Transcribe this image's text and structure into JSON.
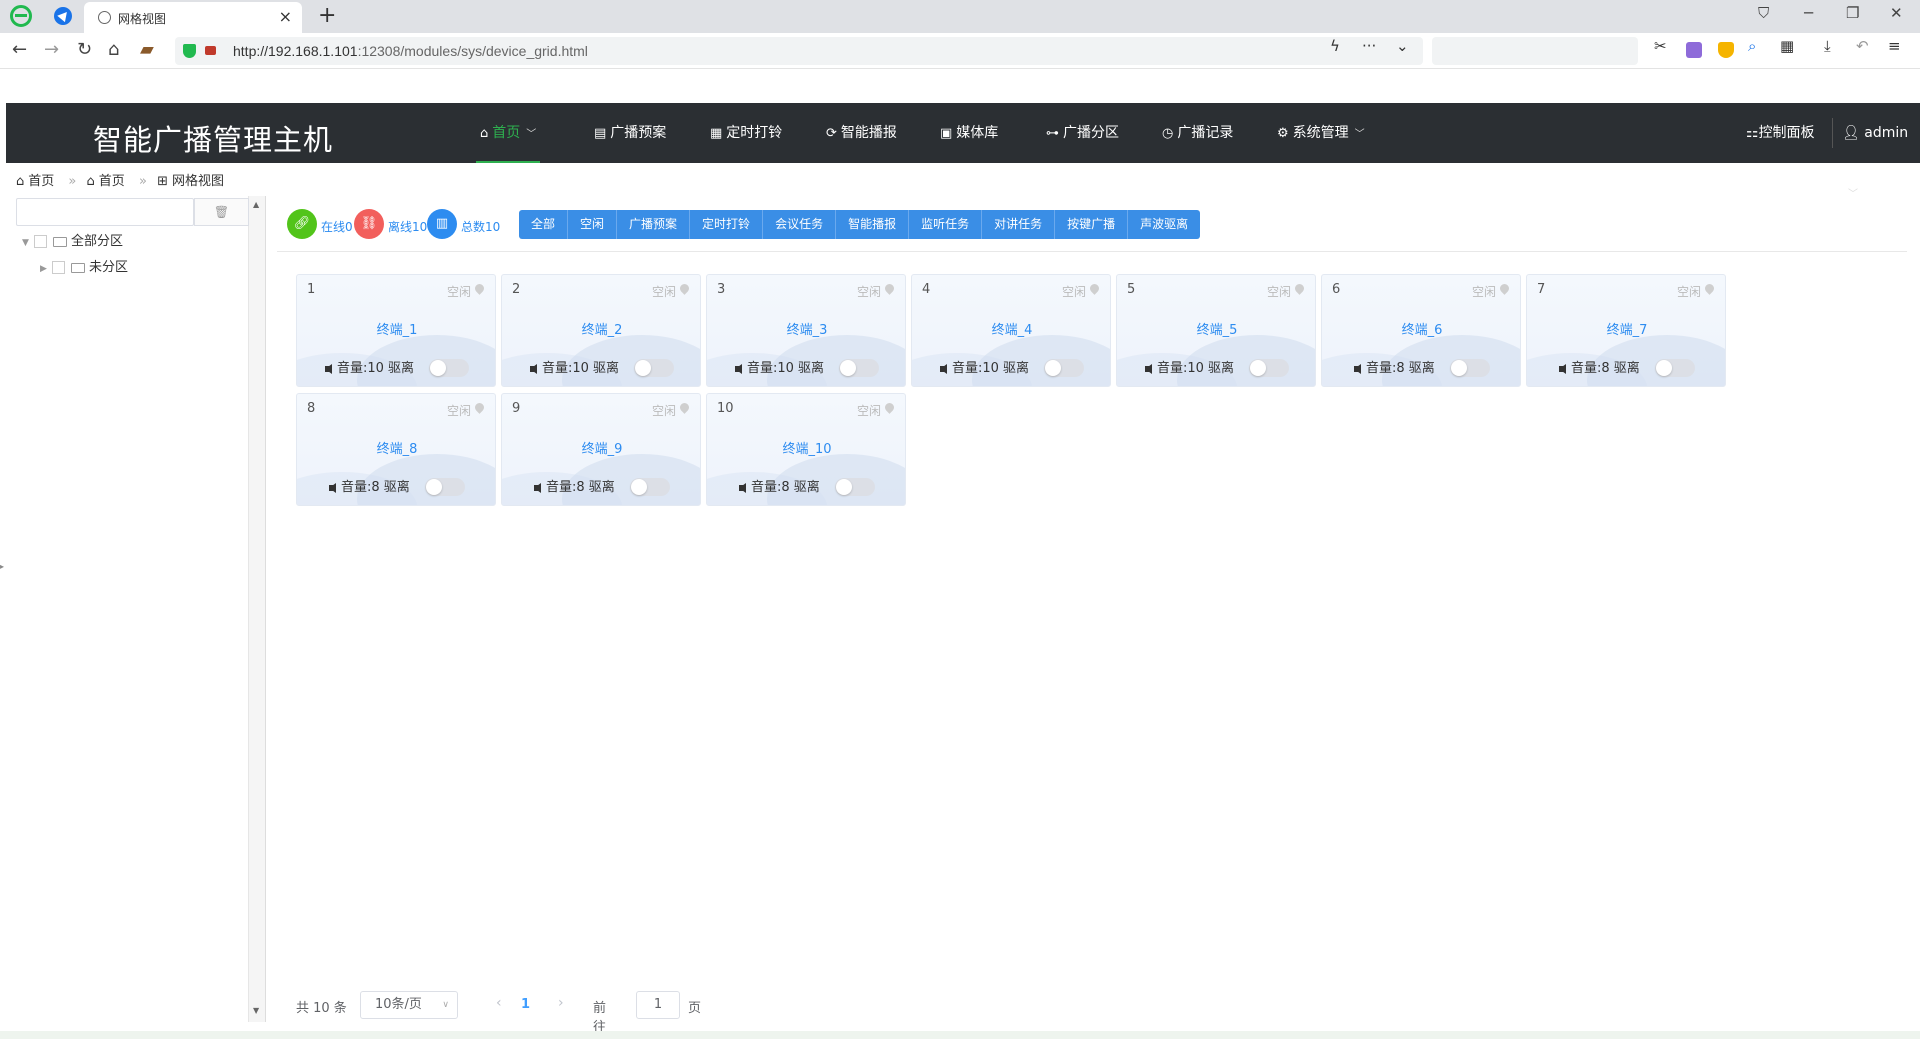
{
  "browser": {
    "tab_title": "网格视图",
    "close_glyph": "×",
    "new_tab_glyph": "+",
    "url_host": "http://192.168.1.101",
    "url_path": ":12308/modules/sys/device_grid.html"
  },
  "app": {
    "title": "智能广播管理主机",
    "nav": [
      {
        "label": "首页",
        "icon": "home-icon"
      },
      {
        "label": "广播预案",
        "icon": "list-icon"
      },
      {
        "label": "定时打铃",
        "icon": "calendar-icon"
      },
      {
        "label": "智能播报",
        "icon": "refresh-icon"
      },
      {
        "label": "媒体库",
        "icon": "media-icon"
      },
      {
        "label": "广播分区",
        "icon": "sitemap-icon"
      },
      {
        "label": "广播记录",
        "icon": "history-icon"
      },
      {
        "label": "系统管理",
        "icon": "gear-icon"
      }
    ],
    "control_panel": "控制面板",
    "user": "admin"
  },
  "breadcrumb": [
    "首页",
    "首页",
    "网格视图"
  ],
  "tree": {
    "clear_icon": "trash-icon",
    "items": [
      "全部分区",
      "未分区"
    ]
  },
  "stats": {
    "online": "在线0",
    "offline": "离线10",
    "total": "总数10",
    "colors": {
      "online": "#52c41a",
      "offline": "#f25f5c",
      "total": "#2d8cf0"
    }
  },
  "filters": [
    "全部",
    "空闲",
    "广播预案",
    "定时打铃",
    "会议任务",
    "智能播报",
    "监听任务",
    "对讲任务",
    "按键广播",
    "声波驱离"
  ],
  "devices": [
    {
      "num": "1",
      "state": "空闲",
      "name": "终端_1",
      "volume": "音量:10 驱离"
    },
    {
      "num": "2",
      "state": "空闲",
      "name": "终端_2",
      "volume": "音量:10 驱离"
    },
    {
      "num": "3",
      "state": "空闲",
      "name": "终端_3",
      "volume": "音量:10 驱离"
    },
    {
      "num": "4",
      "state": "空闲",
      "name": "终端_4",
      "volume": "音量:10 驱离"
    },
    {
      "num": "5",
      "state": "空闲",
      "name": "终端_5",
      "volume": "音量:10 驱离"
    },
    {
      "num": "6",
      "state": "空闲",
      "name": "终端_6",
      "volume": "音量:8 驱离"
    },
    {
      "num": "7",
      "state": "空闲",
      "name": "终端_7",
      "volume": "音量:8 驱离"
    },
    {
      "num": "8",
      "state": "空闲",
      "name": "终端_8",
      "volume": "音量:8 驱离"
    },
    {
      "num": "9",
      "state": "空闲",
      "name": "终端_9",
      "volume": "音量:8 驱离"
    },
    {
      "num": "10",
      "state": "空闲",
      "name": "终端_10",
      "volume": "音量:8 驱离"
    }
  ],
  "pager": {
    "total": "共 10 条",
    "page_size": "10条/页",
    "current": "1",
    "goto": "前往",
    "goto_value": "1",
    "unit": "页"
  }
}
